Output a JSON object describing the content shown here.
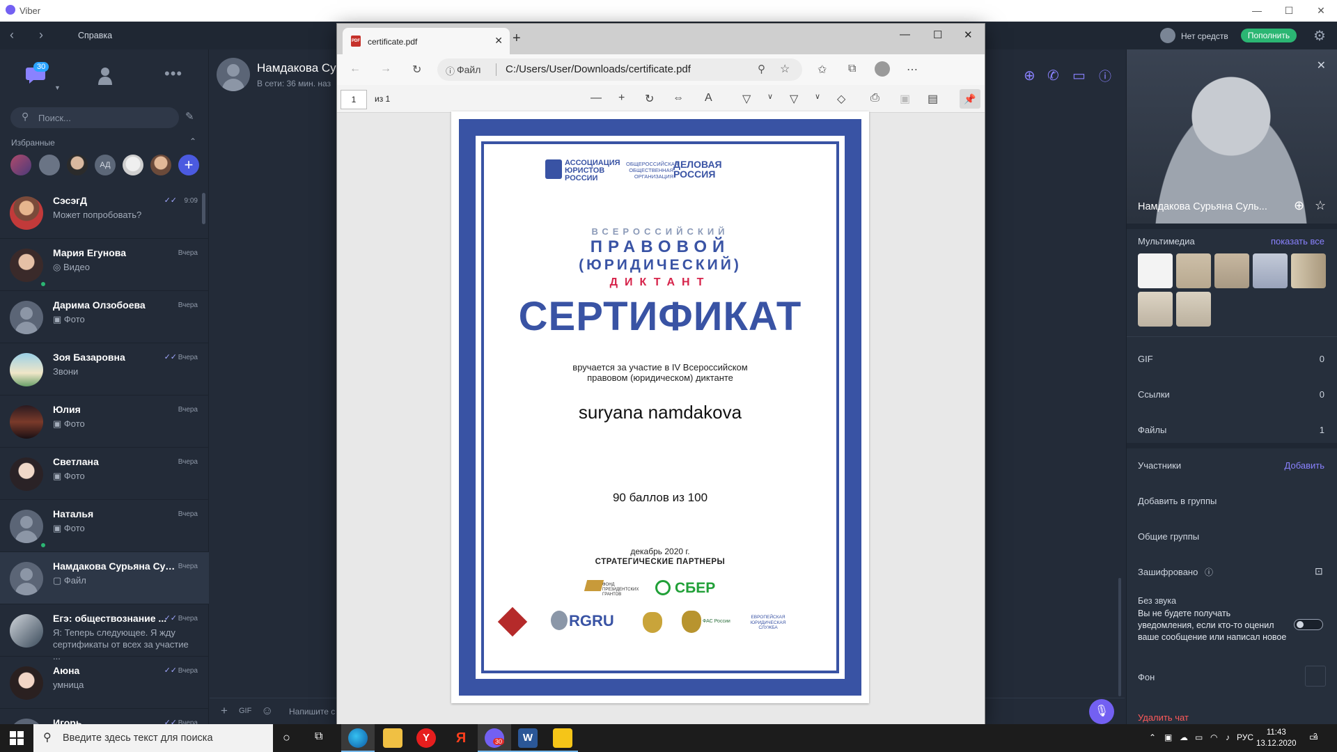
{
  "window": {
    "title": "Viber"
  },
  "viber": {
    "help": "Справка",
    "balance": "Нет средств",
    "topup": "Пополнить",
    "badge": "30",
    "search_placeholder": "Поиск...",
    "favorites_label": "Избранные",
    "favorites_initials": "АД",
    "chats": [
      {
        "name": "СэсэгД",
        "msg": "Может попробовать?",
        "time": "9:09",
        "read": true
      },
      {
        "name": "Мария Егунова",
        "msg": "◎ Видео",
        "time": "Вчера",
        "online": true
      },
      {
        "name": "Дарима Олзобоева",
        "msg": "▣ Фото",
        "time": "Вчера"
      },
      {
        "name": "Зоя Базаровна",
        "msg": "Звони",
        "time": "Вчера",
        "read": true
      },
      {
        "name": "Юлия",
        "msg": "▣ Фото",
        "time": "Вчера"
      },
      {
        "name": "Светлана",
        "msg": "▣ Фото",
        "time": "Вчера"
      },
      {
        "name": "Наталья",
        "msg": "▣ Фото",
        "time": "Вчера",
        "online": true
      },
      {
        "name": "Намдакова Сурьяна Суль...",
        "msg": "▢ Файл",
        "time": "Вчера",
        "selected": true
      },
      {
        "name": "Егэ:  обществознание ...",
        "msg": "Я: Теперь следующее. Я жду сертификаты от всех за участие ...",
        "time": "Вчера",
        "read": true
      },
      {
        "name": "Аюна",
        "msg": "умница",
        "time": "Вчера",
        "read": true
      },
      {
        "name": "Игорь",
        "msg": "",
        "time": "Вчера",
        "read": true
      }
    ],
    "conversation": {
      "name": "Намдакова Сур",
      "status": "В сети: 36 мин. наз",
      "input_placeholder": "Напишите с"
    },
    "info": {
      "name": "Намдакова Сурьяна Суль...",
      "multimedia": "Мультимедиа",
      "show_all": "показать все",
      "gif": "GIF",
      "gif_count": "0",
      "links": "Ссылки",
      "links_count": "0",
      "files": "Файлы",
      "files_count": "1",
      "participants": "Участники",
      "add": "Добавить",
      "add_groups": "Добавить в группы",
      "common_groups": "Общие группы",
      "encrypted": "Зашифровано",
      "mute_title": "Без звука",
      "mute_desc": "Вы не будете получать уведомления, если кто-то оценил ваше сообщение или написал новое",
      "background": "Фон",
      "delete": "Удалить чат"
    }
  },
  "edge": {
    "tab_title": "certificate.pdf",
    "file_label": "Файл",
    "url": "C:/Users/User/Downloads/certificate.pdf",
    "page_num": "1",
    "page_of": "из 1"
  },
  "certificate": {
    "org1": "АССОЦИАЦИЯ ЮРИСТОВ РОССИИ",
    "org2_small": "ОБЩЕРОССИЙСКАЯ ОБЩЕСТВЕННАЯ ОРГАНИЗАЦИЯ",
    "org2": "ДЕЛОВАЯ РОССИЯ",
    "line1": "ВСЕРОССИЙСКИЙ",
    "line2": "ПРАВОВОЙ",
    "line3": "(ЮРИДИЧЕСКИЙ)",
    "line4": "ДИКТАНТ",
    "title": "СЕРТИФИКАТ",
    "award_1": "вручается за участие в IV Всероссийском",
    "award_2": "правовом (юридическом) диктанте",
    "name": "suryana namdakova",
    "score": "90 баллов из 100",
    "date": "декабрь 2020 г.",
    "partners": "СТРАТЕГИЧЕСКИЕ ПАРТНЕРЫ",
    "partner_fund": "ФОНД ПРЕЗИДЕНТСКИХ ГРАНТОВ",
    "partner_sber": "СБЕР",
    "partner_rgru": "RGRU",
    "partner_fas": "ФАС России",
    "partner_euro": "ЕВРОПЕЙСКАЯ ЮРИДИЧЕСКАЯ СЛУЖБА"
  },
  "taskbar": {
    "search_placeholder": "Введите здесь текст для поиска",
    "lang": "РУС",
    "time": "11:43",
    "date": "13.12.2020",
    "viber_badge": "30",
    "notif_count": "2"
  }
}
